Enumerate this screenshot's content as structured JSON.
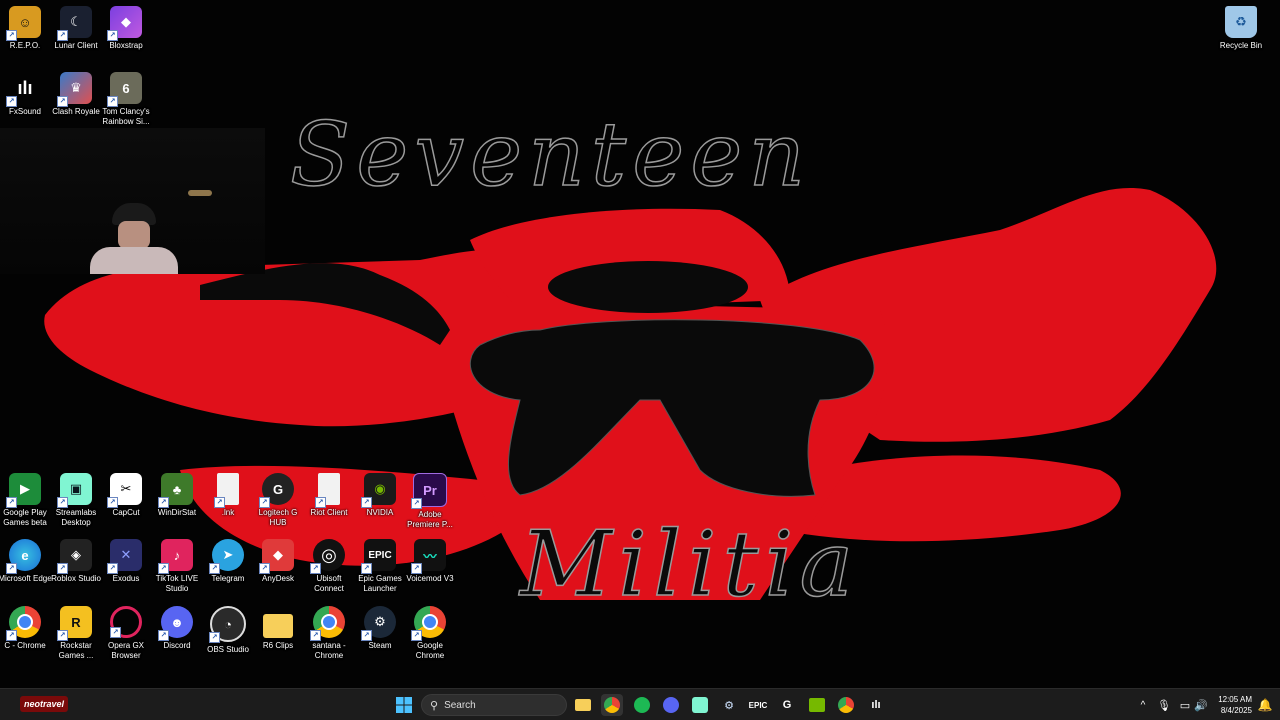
{
  "wallpaper": {
    "top_text": "Seventeen",
    "bottom_text": "Militia",
    "colors": {
      "wings": "#e0101a",
      "figure": "#0a0a0a"
    }
  },
  "desktop_icons": [
    {
      "label": "R.E.P.O.",
      "icon": "repo-icon"
    },
    {
      "label": "Lunar Client",
      "icon": "lunar-client-icon"
    },
    {
      "label": "Bloxstrap",
      "icon": "bloxstrap-icon"
    },
    {
      "label": "Recycle Bin",
      "icon": "recycle-bin-icon"
    },
    {
      "label": "FxSound",
      "icon": "fxsound-icon"
    },
    {
      "label": "Clash Royale",
      "icon": "clash-royale-icon"
    },
    {
      "label": "Tom Clancy's Rainbow Si...",
      "icon": "rainbow-six-icon"
    },
    {
      "label": "Google Play Games beta",
      "icon": "google-play-games-icon"
    },
    {
      "label": "Streamlabs Desktop",
      "icon": "streamlabs-icon"
    },
    {
      "label": "CapCut",
      "icon": "capcut-icon"
    },
    {
      "label": "WinDirStat",
      "icon": "windirstat-icon"
    },
    {
      "label": ".lnk",
      "icon": "file-icon"
    },
    {
      "label": "Logitech G HUB",
      "icon": "logitech-icon"
    },
    {
      "label": "Riot Client",
      "icon": "file-icon"
    },
    {
      "label": "NVIDIA",
      "icon": "nvidia-icon"
    },
    {
      "label": "Adobe Premiere P...",
      "icon": "premiere-icon"
    },
    {
      "label": "Microsoft Edge",
      "icon": "edge-icon"
    },
    {
      "label": "Roblox Studio",
      "icon": "roblox-studio-icon"
    },
    {
      "label": "Exodus",
      "icon": "exodus-icon"
    },
    {
      "label": "TikTok LIVE Studio",
      "icon": "tiktok-icon"
    },
    {
      "label": "Telegram",
      "icon": "telegram-icon"
    },
    {
      "label": "AnyDesk",
      "icon": "anydesk-icon"
    },
    {
      "label": "Ubisoft Connect",
      "icon": "ubisoft-icon"
    },
    {
      "label": "Epic Games Launcher",
      "icon": "epic-games-icon"
    },
    {
      "label": "Voicemod V3",
      "icon": "voicemod-icon"
    },
    {
      "label": "C - Chrome",
      "icon": "chrome-icon"
    },
    {
      "label": "Rockstar Games ...",
      "icon": "rockstar-icon"
    },
    {
      "label": "Opera GX Browser",
      "icon": "opera-gx-icon"
    },
    {
      "label": "Discord",
      "icon": "discord-icon"
    },
    {
      "label": "OBS Studio",
      "icon": "obs-icon"
    },
    {
      "label": "R6 Clips",
      "icon": "folder-icon"
    },
    {
      "label": "santana - Chrome",
      "icon": "chrome-icon"
    },
    {
      "label": "Steam",
      "icon": "steam-icon"
    },
    {
      "label": "Google Chrome",
      "icon": "chrome-icon"
    }
  ],
  "taskbar": {
    "widget_text": "neotravel",
    "search_placeholder": "Search",
    "pinned": [
      "chrome-icon",
      "spotify-icon",
      "discord-icon",
      "streamlabs-icon",
      "steam-icon",
      "epic-games-icon",
      "logitech-icon",
      "nvidia-icon",
      "chrome-icon",
      "fxsound-icon"
    ],
    "time": "12:05 AM",
    "date": "8/4/2025"
  }
}
